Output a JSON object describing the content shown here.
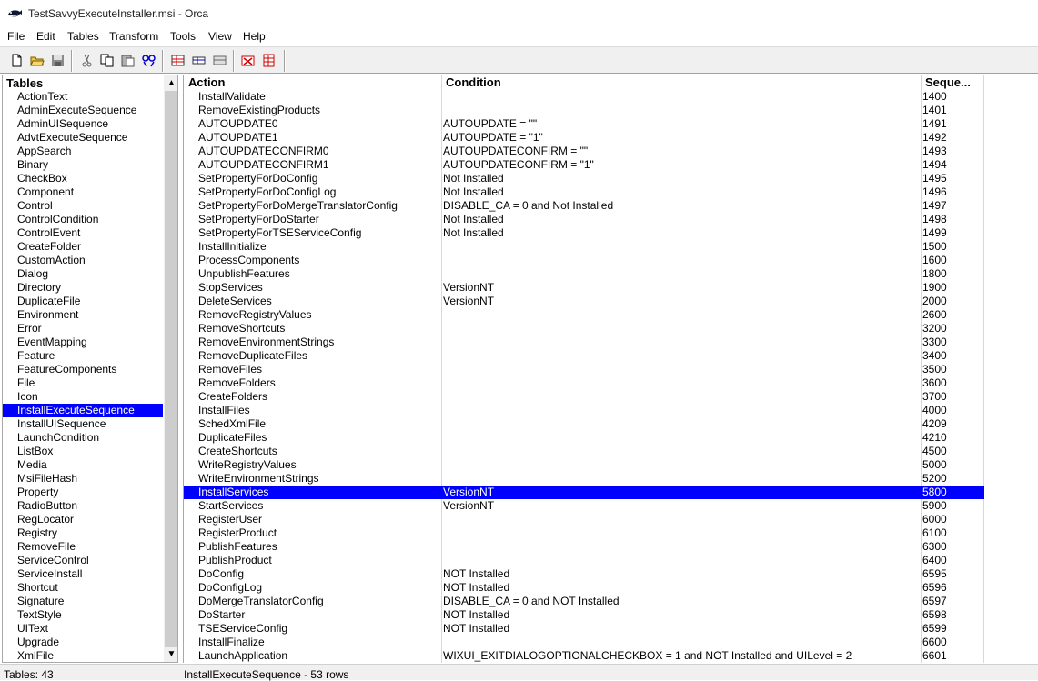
{
  "window": {
    "title": "TestSavvyExecuteInstaller.msi - Orca"
  },
  "menu": [
    "File",
    "Edit",
    "Tables",
    "Transform",
    "Tools",
    "View",
    "Help"
  ],
  "toolbar": [
    "new-icon",
    "open-icon",
    "save-icon",
    "cut-icon",
    "copy-icon",
    "paste-icon",
    "find-icon",
    "table-add-icon",
    "row-add-icon",
    "row-drop-icon",
    "validate-icon",
    "table-drop-icon"
  ],
  "left_pane": {
    "header": "Tables",
    "selected": "InstallExecuteSequence",
    "items": [
      "ActionText",
      "AdminExecuteSequence",
      "AdminUISequence",
      "AdvtExecuteSequence",
      "AppSearch",
      "Binary",
      "CheckBox",
      "Component",
      "Control",
      "ControlCondition",
      "ControlEvent",
      "CreateFolder",
      "CustomAction",
      "Dialog",
      "Directory",
      "DuplicateFile",
      "Environment",
      "Error",
      "EventMapping",
      "Feature",
      "FeatureComponents",
      "File",
      "Icon",
      "InstallExecuteSequence",
      "InstallUISequence",
      "LaunchCondition",
      "ListBox",
      "Media",
      "MsiFileHash",
      "Property",
      "RadioButton",
      "RegLocator",
      "Registry",
      "RemoveFile",
      "ServiceControl",
      "ServiceInstall",
      "Shortcut",
      "Signature",
      "TextStyle",
      "UIText",
      "Upgrade",
      "XmlFile"
    ]
  },
  "table": {
    "columns": [
      "Action",
      "Condition",
      "Seque..."
    ],
    "selected_action": "InstallServices",
    "rows": [
      {
        "action": "InstallValidate",
        "condition": "",
        "sequence": "1400"
      },
      {
        "action": "RemoveExistingProducts",
        "condition": "",
        "sequence": "1401"
      },
      {
        "action": "AUTOUPDATE0",
        "condition": "AUTOUPDATE = \"\"",
        "sequence": "1491"
      },
      {
        "action": "AUTOUPDATE1",
        "condition": "AUTOUPDATE = \"1\"",
        "sequence": "1492"
      },
      {
        "action": "AUTOUPDATECONFIRM0",
        "condition": "AUTOUPDATECONFIRM = \"\"",
        "sequence": "1493"
      },
      {
        "action": "AUTOUPDATECONFIRM1",
        "condition": "AUTOUPDATECONFIRM = \"1\"",
        "sequence": "1494"
      },
      {
        "action": "SetPropertyForDoConfig",
        "condition": "Not Installed",
        "sequence": "1495"
      },
      {
        "action": "SetPropertyForDoConfigLog",
        "condition": "Not Installed",
        "sequence": "1496"
      },
      {
        "action": "SetPropertyForDoMergeTranslatorConfig",
        "condition": "DISABLE_CA = 0 and Not Installed",
        "sequence": "1497"
      },
      {
        "action": "SetPropertyForDoStarter",
        "condition": "Not Installed",
        "sequence": "1498"
      },
      {
        "action": "SetPropertyForTSEServiceConfig",
        "condition": "Not Installed",
        "sequence": "1499"
      },
      {
        "action": "InstallInitialize",
        "condition": "",
        "sequence": "1500"
      },
      {
        "action": "ProcessComponents",
        "condition": "",
        "sequence": "1600"
      },
      {
        "action": "UnpublishFeatures",
        "condition": "",
        "sequence": "1800"
      },
      {
        "action": "StopServices",
        "condition": "VersionNT",
        "sequence": "1900"
      },
      {
        "action": "DeleteServices",
        "condition": "VersionNT",
        "sequence": "2000"
      },
      {
        "action": "RemoveRegistryValues",
        "condition": "",
        "sequence": "2600"
      },
      {
        "action": "RemoveShortcuts",
        "condition": "",
        "sequence": "3200"
      },
      {
        "action": "RemoveEnvironmentStrings",
        "condition": "",
        "sequence": "3300"
      },
      {
        "action": "RemoveDuplicateFiles",
        "condition": "",
        "sequence": "3400"
      },
      {
        "action": "RemoveFiles",
        "condition": "",
        "sequence": "3500"
      },
      {
        "action": "RemoveFolders",
        "condition": "",
        "sequence": "3600"
      },
      {
        "action": "CreateFolders",
        "condition": "",
        "sequence": "3700"
      },
      {
        "action": "InstallFiles",
        "condition": "",
        "sequence": "4000"
      },
      {
        "action": "SchedXmlFile",
        "condition": "",
        "sequence": "4209"
      },
      {
        "action": "DuplicateFiles",
        "condition": "",
        "sequence": "4210"
      },
      {
        "action": "CreateShortcuts",
        "condition": "",
        "sequence": "4500"
      },
      {
        "action": "WriteRegistryValues",
        "condition": "",
        "sequence": "5000"
      },
      {
        "action": "WriteEnvironmentStrings",
        "condition": "",
        "sequence": "5200"
      },
      {
        "action": "InstallServices",
        "condition": "VersionNT",
        "sequence": "5800"
      },
      {
        "action": "StartServices",
        "condition": "VersionNT",
        "sequence": "5900"
      },
      {
        "action": "RegisterUser",
        "condition": "",
        "sequence": "6000"
      },
      {
        "action": "RegisterProduct",
        "condition": "",
        "sequence": "6100"
      },
      {
        "action": "PublishFeatures",
        "condition": "",
        "sequence": "6300"
      },
      {
        "action": "PublishProduct",
        "condition": "",
        "sequence": "6400"
      },
      {
        "action": "DoConfig",
        "condition": "NOT Installed",
        "sequence": "6595"
      },
      {
        "action": "DoConfigLog",
        "condition": "NOT Installed",
        "sequence": "6596"
      },
      {
        "action": "DoMergeTranslatorConfig",
        "condition": "DISABLE_CA = 0 and NOT Installed",
        "sequence": "6597"
      },
      {
        "action": "DoStarter",
        "condition": "NOT Installed",
        "sequence": "6598"
      },
      {
        "action": "TSEServiceConfig",
        "condition": "NOT Installed",
        "sequence": "6599"
      },
      {
        "action": "InstallFinalize",
        "condition": "",
        "sequence": "6600"
      },
      {
        "action": "LaunchApplication",
        "condition": "WIXUI_EXITDIALOGOPTIONALCHECKBOX = 1 and NOT Installed and UILevel = 2",
        "sequence": "6601"
      }
    ]
  },
  "status": {
    "left": "Tables: 43",
    "right": "InstallExecuteSequence - 53 rows"
  },
  "colors": {
    "selection": "#0000ff",
    "chrome": "#f0f0f0"
  }
}
